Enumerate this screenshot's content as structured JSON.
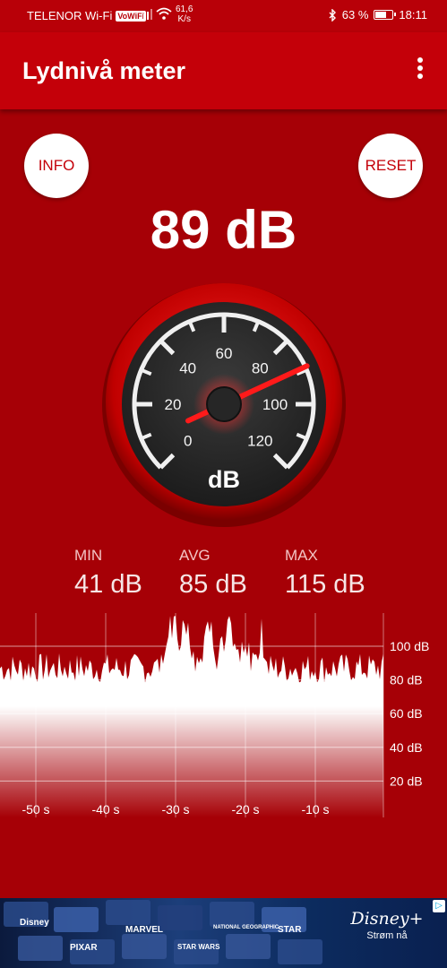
{
  "status_bar": {
    "carrier": "TELENOR Wi-Fi",
    "vowifi": "VoWiFi",
    "speed_value": "61,6",
    "speed_unit": "K/s",
    "battery": "63 %",
    "time": "18:11"
  },
  "appbar": {
    "title": "Lydnivå meter",
    "menu_icon": "more-vert-icon"
  },
  "buttons": {
    "info": "INFO",
    "reset": "RESET"
  },
  "current_level": "89 dB",
  "gauge": {
    "unit": "dB",
    "scale": [
      "0",
      "20",
      "40",
      "60",
      "80",
      "100",
      "120"
    ],
    "min": 0,
    "max": 120,
    "needle_value": 89
  },
  "stats": {
    "min": {
      "label": "MIN",
      "value": "41 dB"
    },
    "avg": {
      "label": "AVG",
      "value": "85 dB"
    },
    "max": {
      "label": "MAX",
      "value": "115 dB"
    }
  },
  "graph": {
    "y_labels": [
      "100 dB",
      "80 dB",
      "60 dB",
      "40 dB",
      "20 dB"
    ],
    "x_labels": [
      "-50 s",
      "-40 s",
      "-30 s",
      "-20 s",
      "-10 s"
    ]
  },
  "ad": {
    "brand": "Disney+",
    "cta": "Strøm nå",
    "tiles": [
      "Disney",
      "PIXAR",
      "MARVEL",
      "STAR WARS",
      "NATIONAL GEOGRAPHIC",
      "STAR"
    ]
  },
  "colors": {
    "background": "#a60006",
    "appbar": "#c40009",
    "needle": "#ff1a1a"
  }
}
